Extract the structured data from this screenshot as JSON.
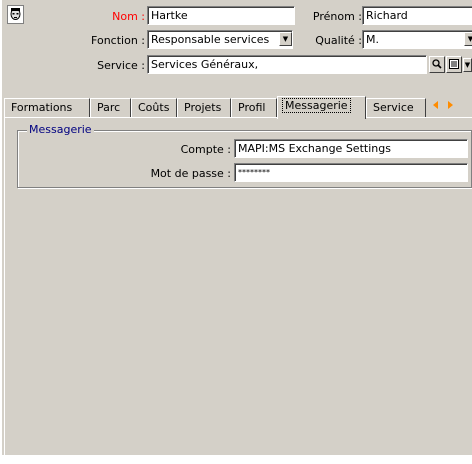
{
  "form": {
    "nom_label": "Nom :",
    "nom_value": "Hartke",
    "prenom_label": "Prénom :",
    "prenom_value": "Richard",
    "fonction_label": "Fonction :",
    "fonction_value": "Responsable services",
    "qualite_label": "Qualité :",
    "qualite_value": "M.",
    "service_label": "Service :",
    "service_value": "Services Généraux,"
  },
  "tabs": [
    {
      "label": "Formations"
    },
    {
      "label": "Parc"
    },
    {
      "label": "Coûts"
    },
    {
      "label": "Projets"
    },
    {
      "label": "Profil"
    },
    {
      "label": "Messagerie"
    },
    {
      "label": "Service"
    }
  ],
  "messagerie": {
    "group_title": "Messagerie",
    "compte_label": "Compte :",
    "compte_value": "MAPI:MS Exchange Settings",
    "password_label": "Mot de passe :",
    "password_value": "********"
  },
  "icons": {
    "avatar": "person-photo-icon",
    "dropdown": "chevron-down-icon",
    "zoom": "magnifier-icon",
    "detail": "detail-icon",
    "prev": "arrow-left-icon",
    "next": "arrow-right-icon"
  },
  "colors": {
    "window_bg": "#d4d0c8",
    "mandatory_label": "#ff0000",
    "group_title": "#000080"
  }
}
